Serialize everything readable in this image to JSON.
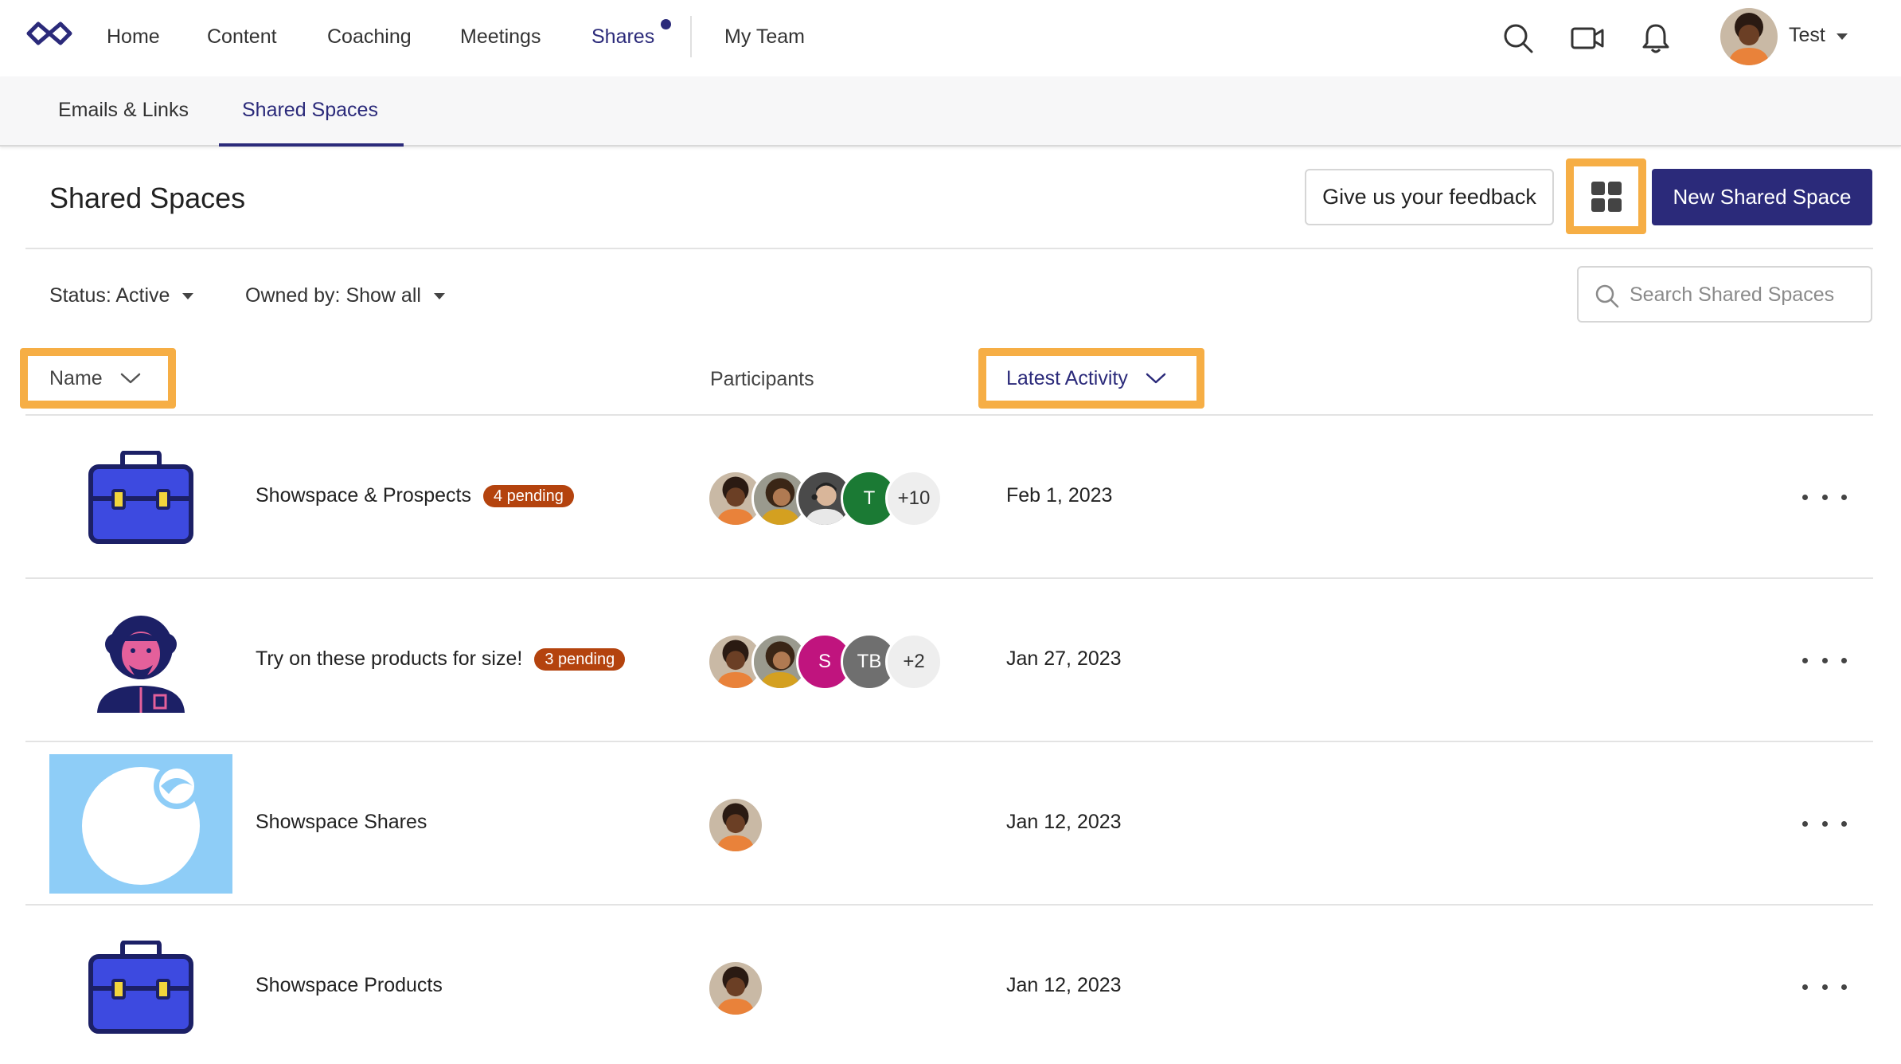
{
  "nav": {
    "items": [
      {
        "label": "Home"
      },
      {
        "label": "Content"
      },
      {
        "label": "Coaching"
      },
      {
        "label": "Meetings"
      },
      {
        "label": "Shares"
      },
      {
        "label": "My Team"
      }
    ],
    "active": "Shares",
    "user_name": "Test"
  },
  "subnav": {
    "tabs": [
      {
        "label": "Emails & Links"
      },
      {
        "label": "Shared Spaces"
      }
    ],
    "active": "Shared Spaces"
  },
  "page": {
    "title": "Shared Spaces",
    "feedback_label": "Give us your feedback",
    "new_label": "New Shared Space"
  },
  "filters": {
    "status": "Status: Active",
    "owned_by": "Owned by: Show all",
    "search_placeholder": "Search Shared Spaces"
  },
  "columns": {
    "name": "Name",
    "participants": "Participants",
    "latest_activity": "Latest Activity"
  },
  "rows": [
    {
      "name": "Showspace & Prospects",
      "pending": "4 pending",
      "thumbnail": "briefcase-icon",
      "participants": [
        "photo",
        "photo",
        "photo",
        "T"
      ],
      "more": "+10",
      "date": "Feb 1, 2023"
    },
    {
      "name": "Try on these products for size!",
      "pending": "3 pending",
      "thumbnail": "person-illustration",
      "participants": [
        "photo",
        "photo",
        "S",
        "TB"
      ],
      "more": "+2",
      "date": "Jan 27, 2023"
    },
    {
      "name": "Showspace Shares",
      "pending": "",
      "thumbnail": "circle-image",
      "participants": [
        "photo"
      ],
      "more": "",
      "date": "Jan 12, 2023"
    },
    {
      "name": "Showspace Products",
      "pending": "",
      "thumbnail": "briefcase-icon",
      "participants": [
        "photo"
      ],
      "more": "",
      "date": "Jan 12, 2023"
    }
  ],
  "colors": {
    "brand": "#2b2a7a",
    "highlight": "#f6ae45",
    "pending": "#b4430e",
    "participant_T": "#1b7a34",
    "participant_S": "#c0147e",
    "participant_TB": "#6f6f6f"
  }
}
